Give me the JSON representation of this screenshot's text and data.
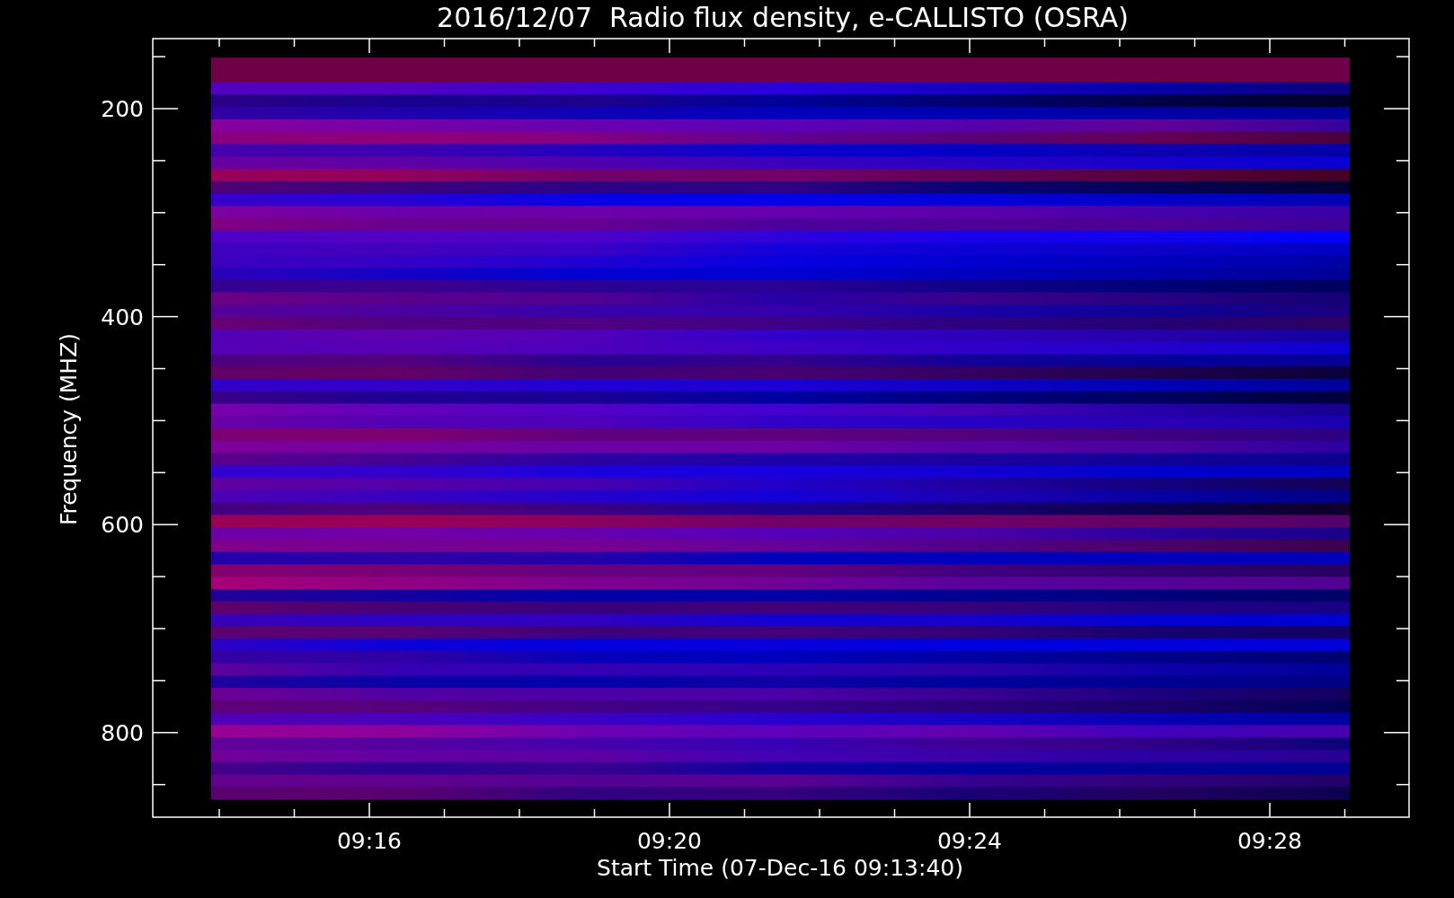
{
  "title": "2016/12/07  Radio flux density, e-CALLISTO (OSRA)",
  "y_axis": {
    "label": "Frequency (MHZ)",
    "ticks": [
      "200",
      "400",
      "600",
      "800"
    ]
  },
  "x_axis": {
    "label": "Start Time (07-Dec-16 09:13:40)",
    "ticks": [
      "09:16",
      "09:20",
      "09:24",
      "09:28"
    ]
  }
}
